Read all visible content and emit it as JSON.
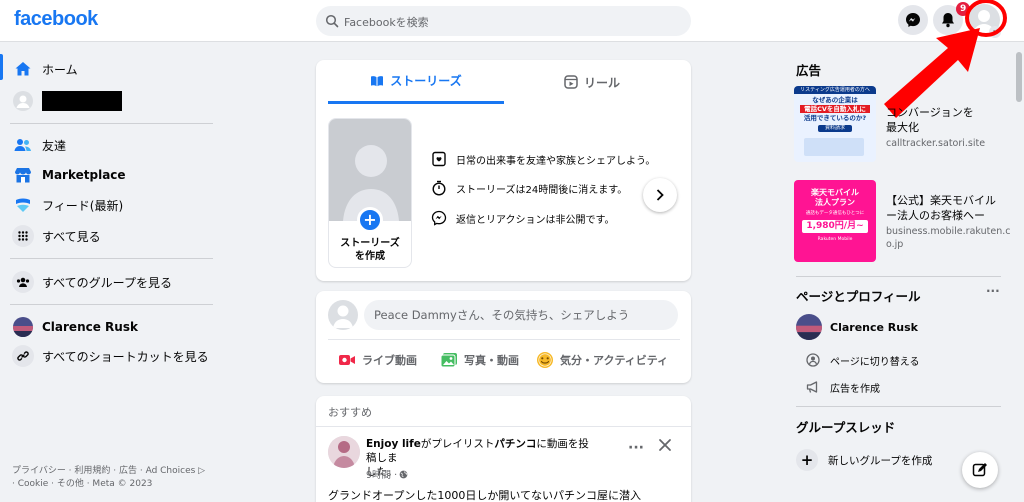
{
  "header": {
    "logo": "facebook",
    "search_placeholder": "Facebookを検索",
    "notification_count": "9"
  },
  "sidebar": {
    "home": "ホーム",
    "friends": "友達",
    "marketplace": "Marketplace",
    "feeds": "フィード(最新)",
    "see_all": "すべて見る",
    "groups": "すべてのグループを見る",
    "profile_name": "Clarence Rusk",
    "shortcuts": "すべてのショートカットを見る"
  },
  "footer": {
    "line1": "プライバシー · 利用規約 · 広告 · Ad Choices ▷",
    "line2": "· Cookie · その他 · Meta © 2023"
  },
  "stories": {
    "tab_stories": "ストーリーズ",
    "tab_reels": "リール",
    "create_line1": "ストーリーズ",
    "create_line2": "を作成",
    "feature1": "日常の出来事を友達や家族とシェアしよう。",
    "feature2": "ストーリーズは24時間後に消えます。",
    "feature3": "返信とリアクションは非公開です。"
  },
  "composer": {
    "placeholder": "Peace Dammyさん、その気持ち、シェアしよう",
    "live": "ライブ動画",
    "photo": "写真・動画",
    "feeling": "気分・アクティビティ"
  },
  "post": {
    "section": "おすすめ",
    "name": "Enjoy life",
    "action_mid": "がプレイリスト",
    "playlist": "パチンコ",
    "action_end": "に動画を投稿しま",
    "action_line2": "した。",
    "time": "9時間 · ",
    "body": "グランドオープンした1000日しか開いてないパチンコ屋に潜入"
  },
  "right": {
    "ads_title": "広告",
    "ad1_title_line1": "コンバージョンを",
    "ad1_title_line2": "最大化",
    "ad1_domain": "calltracker.satori.site",
    "ad1_img_line1": "リスティング広告運用者の方へ",
    "ad1_img_line2": "なぜあの企業は",
    "ad1_img_line3": "電話CVを自動入札に",
    "ad1_img_line4": "活用できているのか?",
    "ad1_img_button": "資料請求",
    "ad2_title_line1": "【公式】楽天モバイル",
    "ad2_title_line2": "ー法人のお客様へー",
    "ad2_domain_line1": "business.mobile.rakuten.c",
    "ad2_domain_line2": "o.jp",
    "ad2_img_line1": "楽天モバイル",
    "ad2_img_line2": "法人プラン",
    "ad2_img_line3": "通話もデータ通信もひとつに",
    "ad2_img_price": "1,980円/月~",
    "ad2_img_brand": "Rakuten Mobile",
    "pages_title": "ページとプロフィール",
    "pages_more": "···",
    "page_name": "Clarence Rusk",
    "switch_page": "ページに切り替える",
    "create_ad": "広告を作成",
    "group_title": "グループスレッド",
    "new_group": "新しいグループを作成"
  },
  "colors": {
    "brand": "#1877f2",
    "annotation_red": "#ff0000"
  }
}
